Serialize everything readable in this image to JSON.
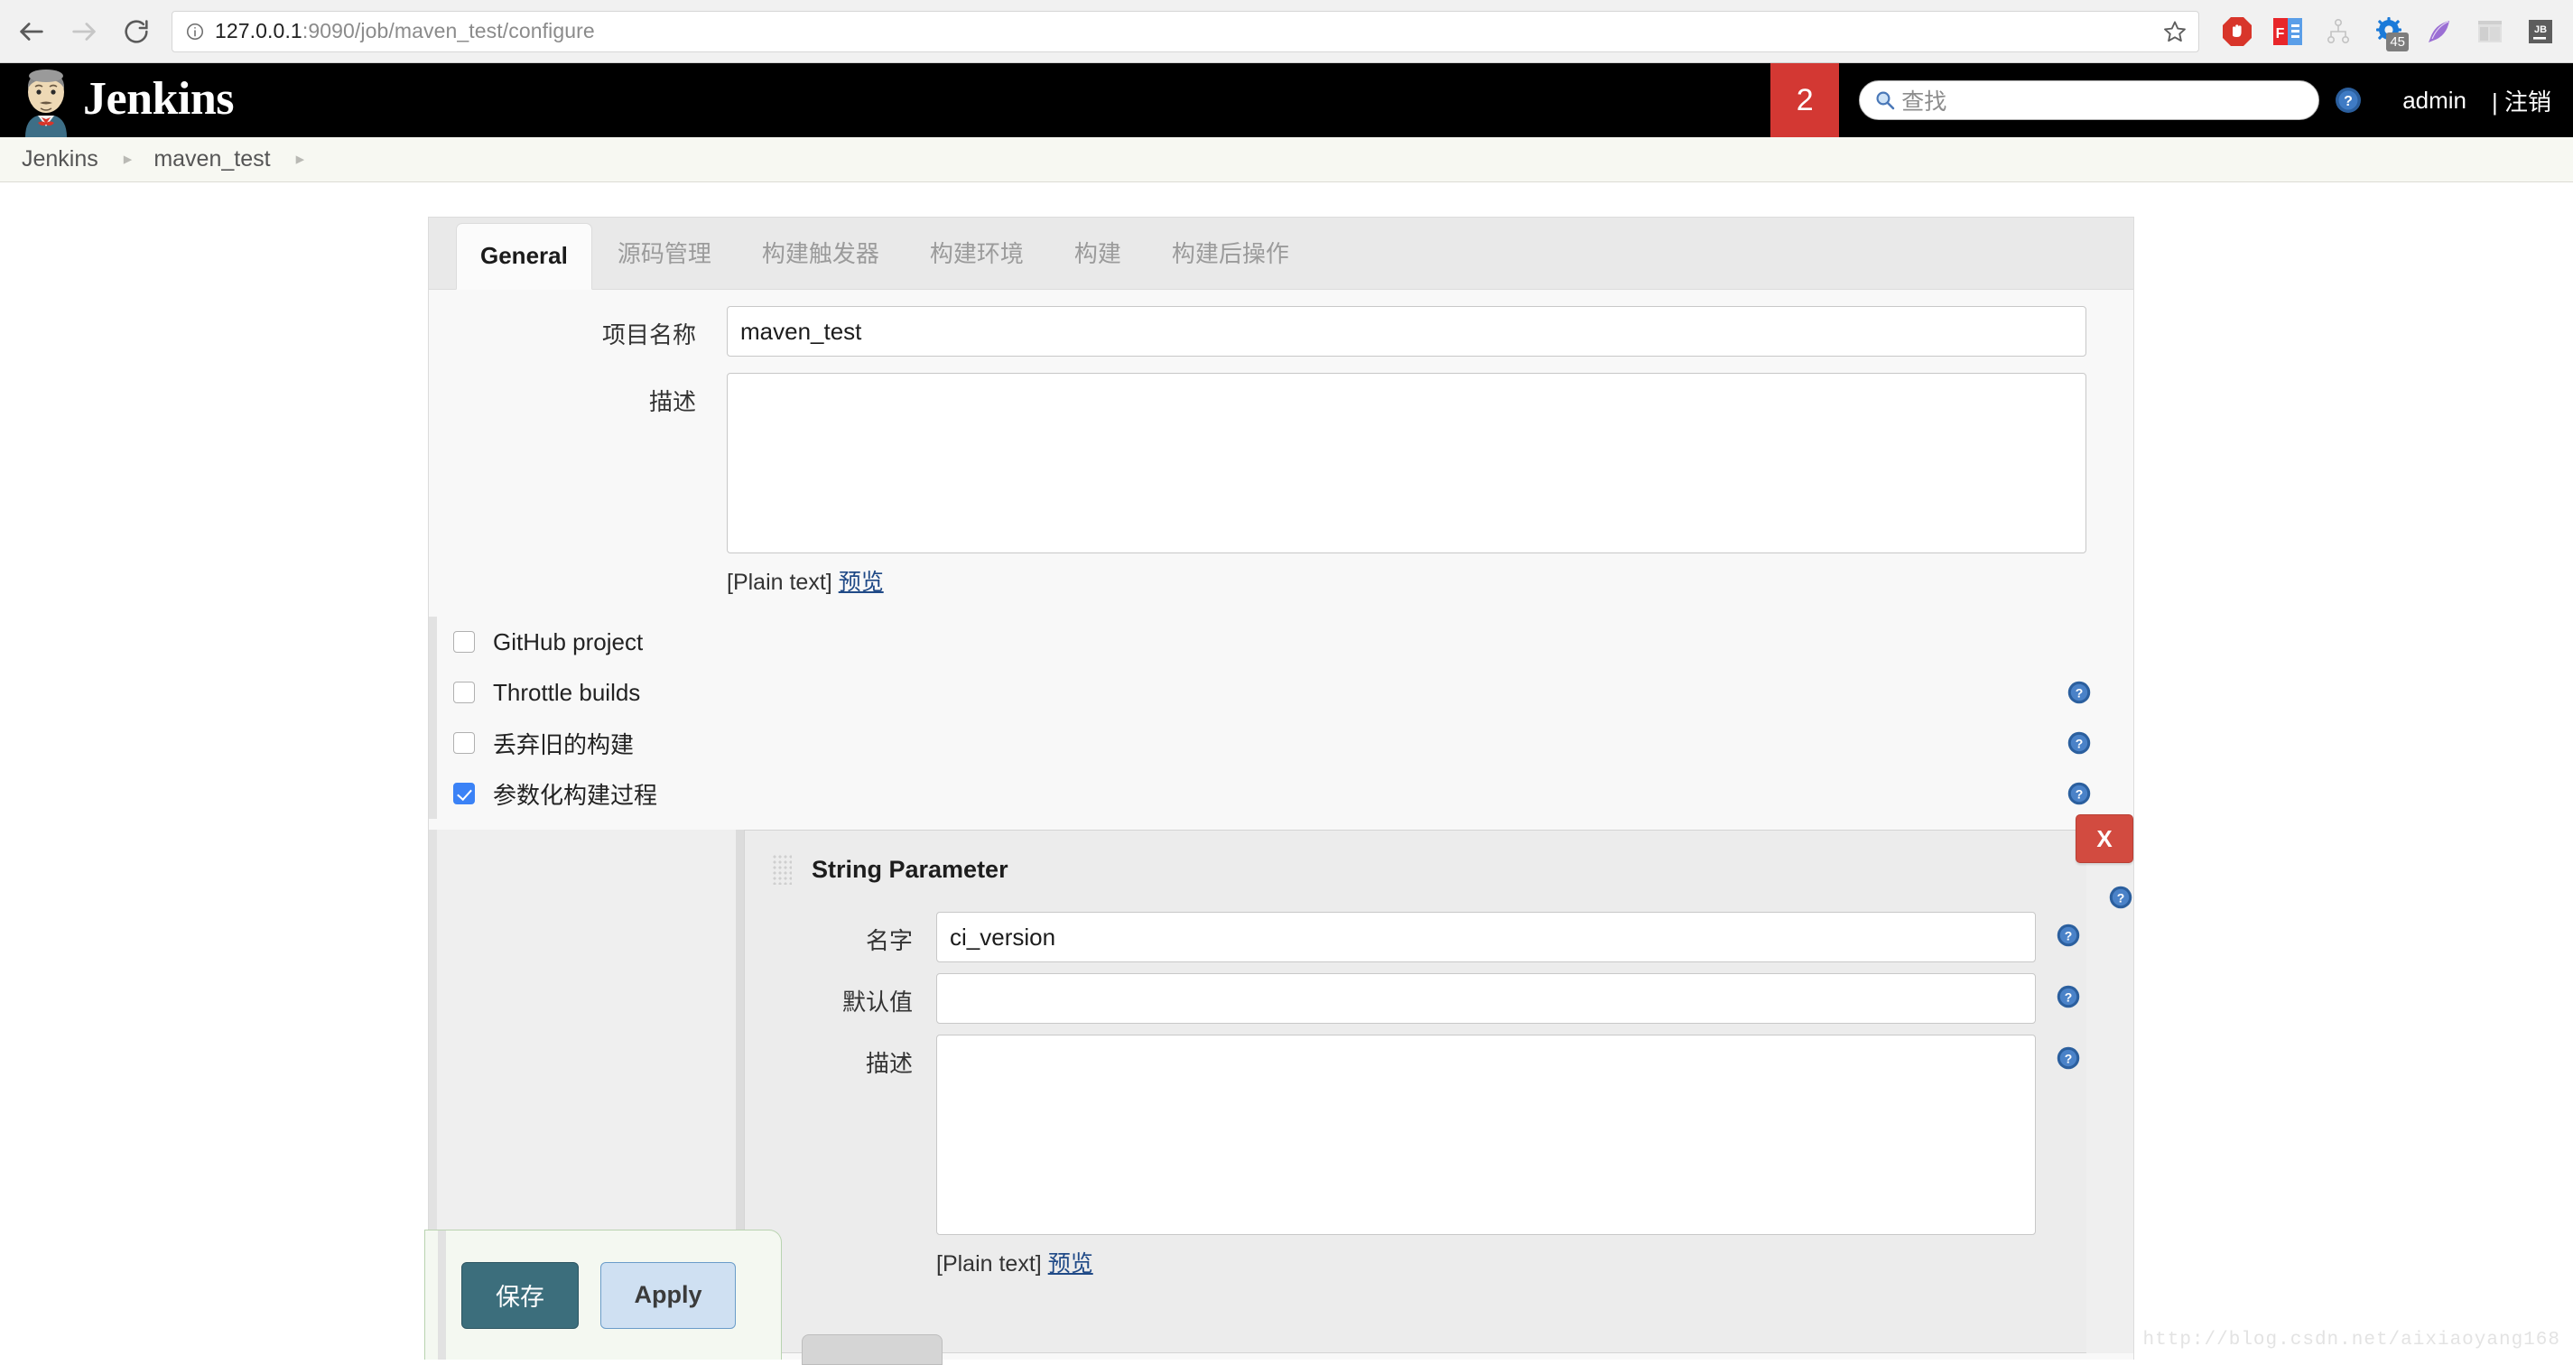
{
  "browser": {
    "url_host": "127.0.0.1",
    "url_rest": ":9090/job/maven_test/configure",
    "back_icon": "back-arrow-icon",
    "forward_icon": "forward-arrow-icon",
    "reload_icon": "reload-icon",
    "info_icon": "page-info-icon",
    "bookmark_icon": "star-icon",
    "extensions": [
      {
        "name": "adblock-icon",
        "label": "AdBlock"
      },
      {
        "name": "fe-extension-icon",
        "label": "FE"
      },
      {
        "name": "sitemap-icon",
        "label": "Sitemap"
      },
      {
        "name": "gear-extension-icon",
        "label": "Settings",
        "badge": "45"
      },
      {
        "name": "feather-icon",
        "label": "Feather"
      },
      {
        "name": "layout-icon",
        "label": "Layout"
      },
      {
        "name": "jetbrains-icon",
        "label": "JB"
      }
    ]
  },
  "header": {
    "logo_name": "jenkins-butler-logo",
    "title": "Jenkins",
    "queue_count": "2",
    "search_placeholder": "查找",
    "search_icon": "search-icon",
    "help_icon": "help-icon",
    "user": "admin",
    "logout": "| 注销"
  },
  "breadcrumb": {
    "items": [
      "Jenkins",
      "maven_test"
    ],
    "separator": "▸"
  },
  "tabs": [
    {
      "label": "General",
      "active": true
    },
    {
      "label": "源码管理",
      "active": false
    },
    {
      "label": "构建触发器",
      "active": false
    },
    {
      "label": "构建环境",
      "active": false
    },
    {
      "label": "构建",
      "active": false
    },
    {
      "label": "构建后操作",
      "active": false
    }
  ],
  "form": {
    "project_name_label": "项目名称",
    "project_name_value": "maven_test",
    "description_label": "描述",
    "description_value": "",
    "plain_text_prefix": "[Plain text]",
    "preview_link": "预览"
  },
  "checkboxes": [
    {
      "label": "GitHub project",
      "checked": false,
      "has_help": false
    },
    {
      "label": "Throttle builds",
      "checked": false,
      "has_help": true
    },
    {
      "label": "丢弃旧的构建",
      "checked": false,
      "has_help": true
    },
    {
      "label": "参数化构建过程",
      "checked": true,
      "has_help": true
    }
  ],
  "parameter": {
    "title": "String Parameter",
    "grip_icon": "drag-handle-icon",
    "delete_label": "X",
    "name_label": "名字",
    "name_value": "ci_version",
    "default_label": "默认值",
    "default_value": "",
    "description_label": "描述",
    "description_value": "",
    "plain_text_prefix": "[Plain text]",
    "preview_link": "预览"
  },
  "actions": {
    "save_label": "保存",
    "apply_label": "Apply"
  },
  "watermark": "http://blog.csdn.net/aixiaoyang168",
  "colors": {
    "jenkins_header": "#000000",
    "queue_badge": "#d33833",
    "accent_checkbox": "#3b82f6",
    "save_button": "#3c6e7c",
    "apply_button": "#cfe0f2",
    "delete_button": "#d24b40",
    "link": "#204a87"
  }
}
